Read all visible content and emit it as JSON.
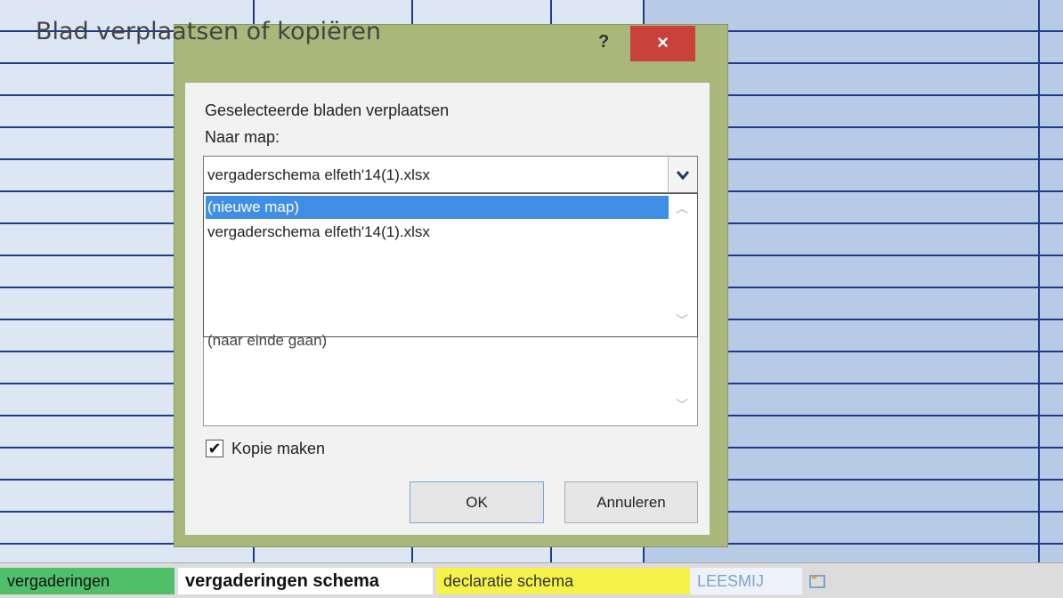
{
  "dialog": {
    "title": "Blad verplaatsen of kopiëren",
    "help": "?",
    "close": "×",
    "move_label": "Geselecteerde bladen verplaatsen",
    "to_book_label": "Naar map:",
    "to_book_value": "vergaderschema elfeth'14(1).xlsx",
    "dropdown_options": [
      "(nieuwe map)",
      "vergaderschema elfeth'14(1).xlsx"
    ],
    "selected_option_index": 0,
    "before_sheet_visible_item": "(naar einde gaan)",
    "copy_checkbox_label": "Kopie maken",
    "copy_checked": true,
    "ok_label": "OK",
    "cancel_label": "Annuleren"
  },
  "sheet_tabs": [
    "vergaderingen",
    "vergaderingen schema",
    "declaratie schema",
    "LEESMIJ"
  ],
  "active_tab": "vergaderingen schema",
  "icons": {
    "dropdown": "chevron-down-icon",
    "checkbox": "checkmark-icon",
    "close": "close-icon",
    "help": "help-icon",
    "new_sheet": "new-sheet-icon"
  }
}
